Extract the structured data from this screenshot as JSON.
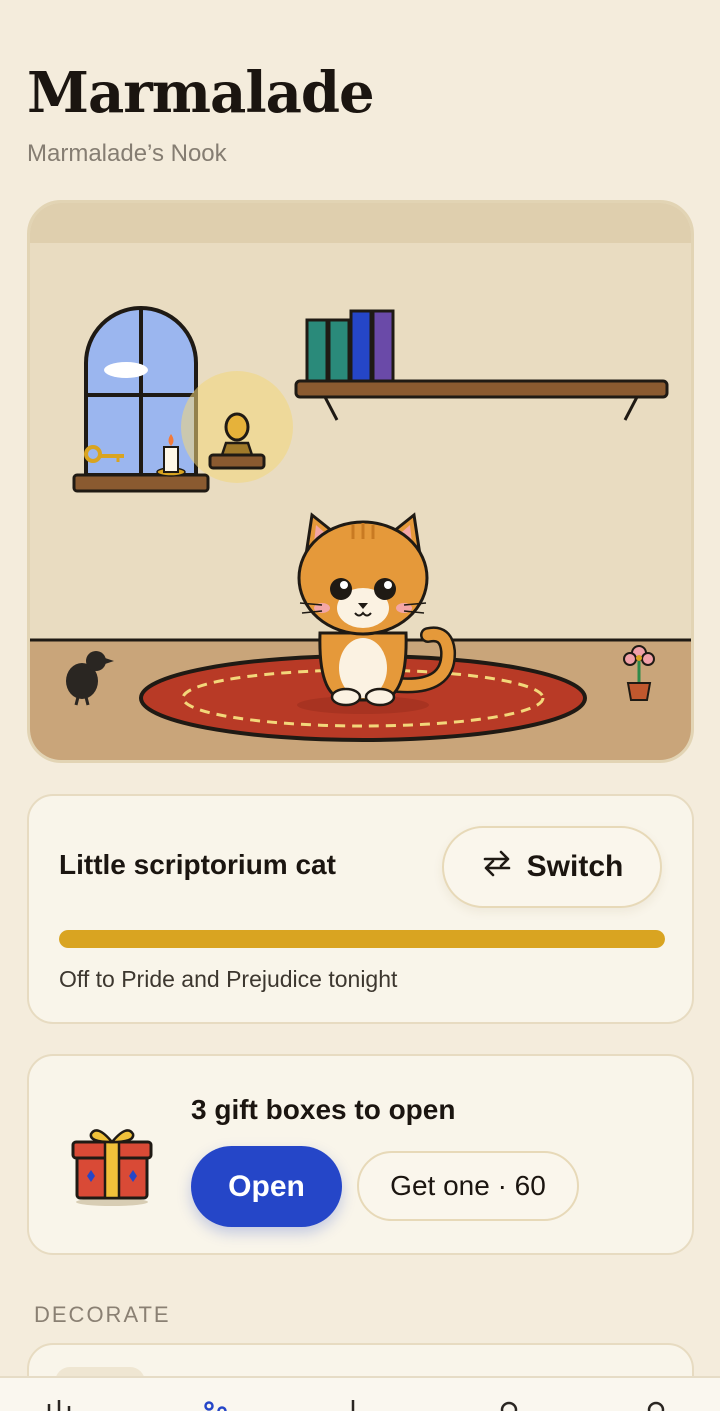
{
  "header": {
    "title": "Marmalade",
    "subtitle": "Marmalade’s Nook"
  },
  "pet_card": {
    "name": "Little scriptorium cat",
    "switch_label": "Switch",
    "progress_fraction": 1.0,
    "status": "Off to Pride and Prejudice tonight"
  },
  "gift_card": {
    "title": "3 gift boxes to open",
    "open_label": "Open",
    "get_one_label": "Get one · 60"
  },
  "sections": {
    "decorate_label": "DECORATE"
  },
  "tab_bar": {
    "icons": [
      "stats-icon",
      "paw-icon",
      "shop-icon",
      "friends-icon",
      "profile-icon"
    ],
    "active_index": 1
  },
  "colors": {
    "accent_blue": "#2546c8",
    "progress_gold": "#d9a421",
    "background": "#f4ecdc"
  }
}
